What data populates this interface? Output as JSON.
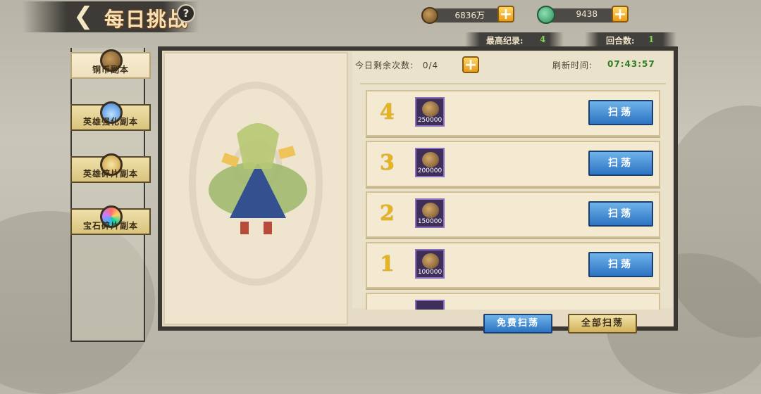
{
  "title": "每日挑战",
  "resources": {
    "copper": "6836万",
    "jade": "9438"
  },
  "stats": {
    "best_label": "最高纪录:",
    "best_value": "4",
    "round_label": "回合数:",
    "round_value": "1"
  },
  "sidebar": {
    "items": [
      {
        "label": "铜币副本",
        "active": true,
        "icon": "copper-coin-icon"
      },
      {
        "label": "英雄强化副本",
        "active": false,
        "icon": "blue-flame-icon"
      },
      {
        "label": "英雄碎片副本",
        "active": false,
        "icon": "puzzle-piece-icon"
      },
      {
        "label": "宝石碎片副本",
        "active": false,
        "icon": "gem-icon"
      }
    ]
  },
  "main": {
    "remain_label": "今日剩余次数:",
    "remain_value": "0/4",
    "refresh_label": "刷新时间:",
    "refresh_time": "07:43:57",
    "stages": [
      {
        "level": "4",
        "reward": "250000",
        "button": "扫荡"
      },
      {
        "level": "3",
        "reward": "200000",
        "button": "扫荡"
      },
      {
        "level": "2",
        "reward": "150000",
        "button": "扫荡"
      },
      {
        "level": "1",
        "reward": "100000",
        "button": "扫荡"
      }
    ],
    "free_sweep": "免费扫荡",
    "sweep_all": "全部扫荡"
  },
  "colors": {
    "accent_gold": "#e8b41d",
    "button_blue": "#2c73c2",
    "timer_green": "#2f7d24"
  }
}
